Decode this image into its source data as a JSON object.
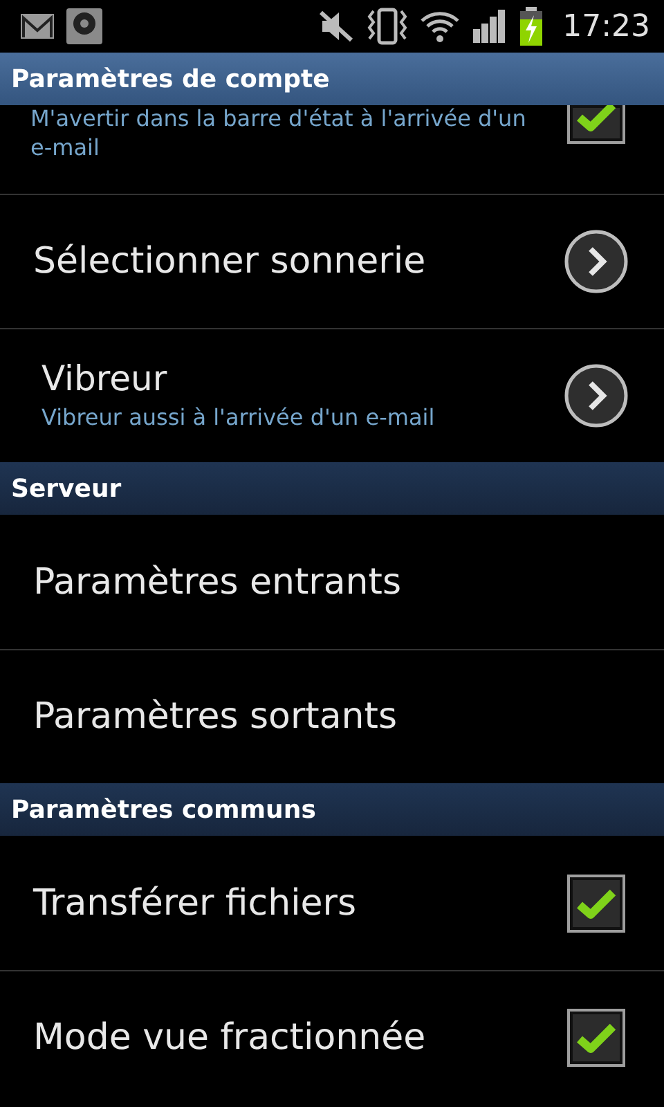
{
  "status_bar": {
    "time": "17:23"
  },
  "sections": [
    {
      "title": "Paramètres de compte",
      "items": [
        {
          "kind": "checkbox",
          "summary": "M'avertir dans la barre d'état à l'arrivée d'un e-mail",
          "checked": true,
          "cut": true
        },
        {
          "kind": "arrow",
          "title": "Sélectionner sonnerie"
        },
        {
          "kind": "arrow",
          "title": "Vibreur",
          "summary": "Vibreur aussi à l'arrivée d'un e-mail"
        }
      ]
    },
    {
      "title": "Serveur",
      "items": [
        {
          "kind": "plain",
          "title": "Paramètres entrants"
        },
        {
          "kind": "plain",
          "title": "Paramètres sortants"
        }
      ]
    },
    {
      "title": "Paramètres communs",
      "items": [
        {
          "kind": "checkbox",
          "title": "Transférer fichiers",
          "checked": true
        },
        {
          "kind": "checkbox",
          "title": "Mode vue fractionnée",
          "checked": true
        }
      ]
    }
  ]
}
